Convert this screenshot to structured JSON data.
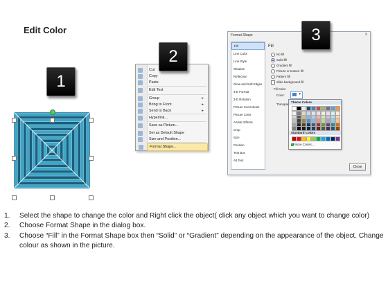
{
  "title": "Edit Color",
  "badges": [
    "1",
    "2",
    "3"
  ],
  "context_menu": {
    "items": [
      {
        "label": "Cut",
        "submenu": false
      },
      {
        "label": "Copy",
        "submenu": false
      },
      {
        "label": "Paste",
        "submenu": false
      },
      {
        "label": "Edit Text",
        "submenu": false
      },
      {
        "label": "Group",
        "submenu": true
      },
      {
        "label": "Bring to Front",
        "submenu": true
      },
      {
        "label": "Send to Back",
        "submenu": true
      },
      {
        "label": "Hyperlink...",
        "submenu": false
      },
      {
        "label": "Save as Picture...",
        "submenu": false
      },
      {
        "label": "Set as Default Shape",
        "submenu": false
      },
      {
        "label": "Size and Position...",
        "submenu": false
      },
      {
        "label": "Format Shape...",
        "submenu": false
      }
    ]
  },
  "dialog": {
    "title": "Format Shape",
    "close_x": "x",
    "nav": [
      "Fill",
      "Line Color",
      "Line Style",
      "Shadow",
      "Reflection",
      "Glow and Soft Edges",
      "3-D Format",
      "3-D Rotation",
      "Picture Corrections",
      "Picture Color",
      "Artistic Effects",
      "Crop",
      "Size",
      "Position",
      "Text Box",
      "Alt Text"
    ],
    "section": "Fill",
    "options": [
      "No fill",
      "Solid fill",
      "Gradient fill",
      "Picture or texture fill",
      "Pattern fill",
      "Slide background fill"
    ],
    "fill_color": "Fill Color",
    "color_label": "Color:",
    "transparency_label": "Transparency:",
    "close_button": "Close"
  },
  "palette": {
    "theme_colors_label": "Theme Colors",
    "standard_colors_label": "Standard Colors",
    "more_colors": "More Colors...",
    "theme_top": [
      "#ffffff",
      "#000000",
      "#eeece1",
      "#1f497d",
      "#4f81bd",
      "#c0504d",
      "#9bbb59",
      "#8064a2",
      "#4bacc6",
      "#f79646"
    ],
    "theme_shades": [
      [
        "#f2f2f2",
        "#7f7f7f",
        "#ddd9c3",
        "#c6d9f0",
        "#dbe5f1",
        "#f2dcdb",
        "#ebf1dd",
        "#e5e0ec",
        "#dbeef3",
        "#fdeada"
      ],
      [
        "#d8d8d8",
        "#595959",
        "#c4bd97",
        "#8db3e2",
        "#b8cce4",
        "#e5b9b7",
        "#d7e3bc",
        "#ccc1d9",
        "#b7dde8",
        "#fbd5b5"
      ],
      [
        "#bfbfbf",
        "#3f3f3f",
        "#938953",
        "#548dd4",
        "#95b3d7",
        "#d99694",
        "#c3d69b",
        "#b2a2c7",
        "#92cddc",
        "#fac08f"
      ],
      [
        "#a5a5a5",
        "#262626",
        "#494429",
        "#17365d",
        "#366092",
        "#953734",
        "#76923c",
        "#5f497a",
        "#31859b",
        "#e36c09"
      ],
      [
        "#7f7f7f",
        "#0c0c0c",
        "#1d1b10",
        "#0f243e",
        "#244061",
        "#632423",
        "#4f6128",
        "#3f3151",
        "#205867",
        "#974806"
      ]
    ],
    "standard": [
      "#c00000",
      "#ff0000",
      "#ffc000",
      "#ffff00",
      "#92d050",
      "#00b050",
      "#00b0f0",
      "#0070c0",
      "#002060",
      "#7030a0"
    ]
  },
  "steps": [
    "Select the shape to change the color and Right click the object( click any object which you want to change color)",
    "Choose Format Shape in the dialog box.",
    "Choose “Fill” in the Format Shape box then “Solid” or “Gradient” depending on the appearance of the object. Change colour as shown in the picture."
  ],
  "step_numbers": [
    "1.",
    "2.",
    "3."
  ],
  "colors": {
    "pyramid_fill": "#3aa6c9",
    "pyramid_stripe": "#1a5f7d",
    "badge": "#000000"
  }
}
